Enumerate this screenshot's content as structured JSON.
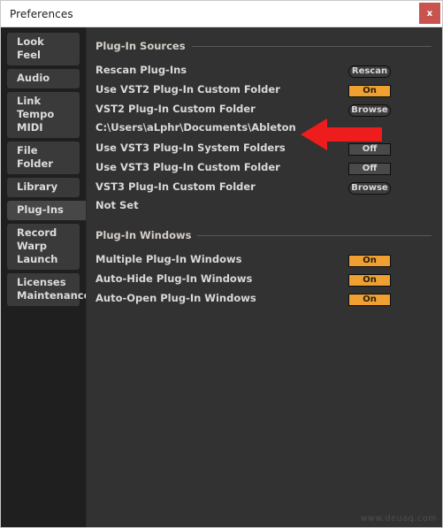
{
  "window": {
    "title": "Preferences",
    "close_label": "x"
  },
  "sidebar": {
    "groups": [
      {
        "id": "look-feel",
        "lines": [
          "Look",
          "Feel"
        ],
        "selected": false
      },
      {
        "id": "audio",
        "lines": [
          "Audio"
        ],
        "selected": false
      },
      {
        "id": "link-tempo-midi",
        "lines": [
          "Link",
          "Tempo",
          "MIDI"
        ],
        "selected": false
      },
      {
        "id": "file-folder",
        "lines": [
          "File",
          "Folder"
        ],
        "selected": false
      },
      {
        "id": "library",
        "lines": [
          "Library"
        ],
        "selected": false
      },
      {
        "id": "plug-ins",
        "lines": [
          "Plug-Ins"
        ],
        "selected": true
      },
      {
        "id": "record-warp-launch",
        "lines": [
          "Record",
          "Warp",
          "Launch"
        ],
        "selected": false
      },
      {
        "id": "licenses-maintenance",
        "lines": [
          "Licenses",
          "Maintenance"
        ],
        "selected": false
      }
    ]
  },
  "sections": [
    {
      "title": "Plug-In Sources",
      "rows": [
        {
          "type": "row",
          "label": "Rescan Plug-Ins",
          "control": "pill",
          "value": "Rescan"
        },
        {
          "type": "row",
          "label": "Use VST2 Plug-In Custom Folder",
          "control": "toggle",
          "value": "On",
          "state": "on"
        },
        {
          "type": "row",
          "label": "VST2 Plug-In Custom Folder",
          "control": "pill",
          "value": "Browse"
        },
        {
          "type": "path",
          "label": "C:\\Users\\aLphr\\Documents\\Ableton"
        },
        {
          "type": "row",
          "label": "Use VST3 Plug-In System Folders",
          "control": "toggle",
          "value": "Off",
          "state": "off"
        },
        {
          "type": "row",
          "label": "Use VST3 Plug-In Custom Folder",
          "control": "toggle",
          "value": "Off",
          "state": "off"
        },
        {
          "type": "row",
          "label": "VST3 Plug-In Custom Folder",
          "control": "pill",
          "value": "Browse"
        },
        {
          "type": "path",
          "label": "Not Set"
        }
      ]
    },
    {
      "title": "Plug-In Windows",
      "rows": [
        {
          "type": "row",
          "label": "Multiple Plug-In Windows",
          "control": "toggle",
          "value": "On",
          "state": "on"
        },
        {
          "type": "row",
          "label": "Auto-Hide Plug-In Windows",
          "control": "toggle",
          "value": "On",
          "state": "on"
        },
        {
          "type": "row",
          "label": "Auto-Open Plug-In Windows",
          "control": "toggle",
          "value": "On",
          "state": "on"
        }
      ]
    }
  ],
  "annotation": {
    "arrow_color": "#ee1c1c",
    "points_to": "VST2 Plug-In Custom Folder Browse button"
  },
  "watermark": {
    "text": "www.deuaq.com"
  },
  "colors": {
    "window_bg": "#323232",
    "sidebar_bg": "#1f1f1f",
    "accent_on": "#f0a030",
    "titlebar_bg": "#ffffff",
    "close_bg": "#c8534f"
  }
}
